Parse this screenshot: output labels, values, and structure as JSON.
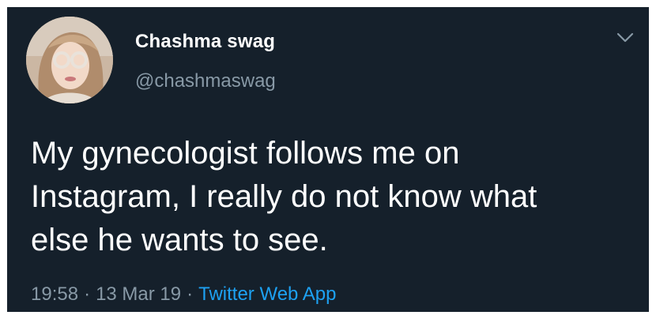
{
  "tweet": {
    "author": {
      "display_name": "Chashma swag",
      "handle": "@chashmaswag",
      "avatar_icon": "profile-photo"
    },
    "text": "My gynecologist follows me on\nInstagram, I really do not know what\nelse he wants to see.",
    "time": "19:58",
    "date": "13 Mar 19",
    "separator": "·",
    "source": "Twitter Web App",
    "menu_icon": "chevron-down-icon"
  },
  "colors": {
    "background": "#15202b",
    "text": "#ffffff",
    "muted": "#8899a6",
    "link": "#1da1f2"
  }
}
